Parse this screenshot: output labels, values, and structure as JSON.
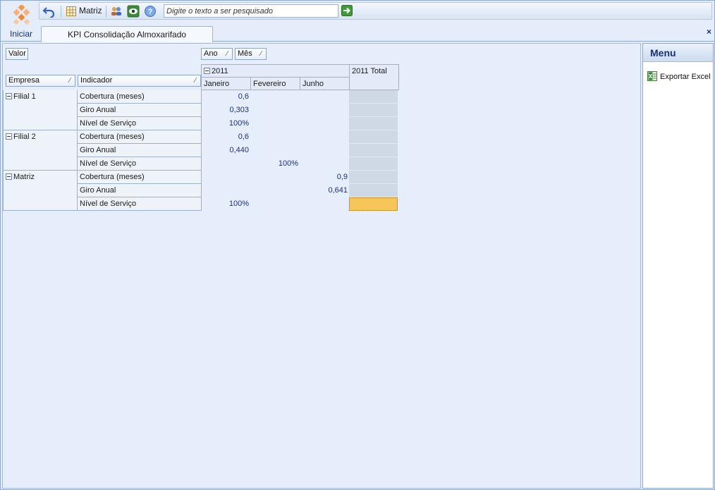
{
  "app": {
    "start_label": "Iniciar",
    "tab_label": "KPI Consolidação Almoxarifado",
    "close_glyph": "×"
  },
  "toolbar": {
    "undo_icon": "undo-icon",
    "matrix_icon": "grid-icon",
    "matrix_label": "Matriz",
    "users_icon": "users-icon",
    "view_icon": "eye-icon",
    "help_icon": "help-icon",
    "search_placeholder": "Digite o texto a ser pesquisado",
    "go_icon": "arrow-right-icon"
  },
  "pivot": {
    "data_field": "Valor",
    "column_fields": [
      "Ano",
      "Mês"
    ],
    "row_fields": [
      "Empresa",
      "Indicador"
    ],
    "year": "2011",
    "year_total": "2011 Total",
    "months": [
      "Janeiro",
      "Fevereiro",
      "Junho"
    ],
    "groups": [
      {
        "name": "Filial 1",
        "rows": [
          {
            "indicator": "Cobertura (meses)",
            "values": [
              "0,6",
              "",
              ""
            ]
          },
          {
            "indicator": "Giro Anual",
            "values": [
              "0,303",
              "",
              ""
            ]
          },
          {
            "indicator": "Nível de Serviço",
            "values": [
              "100%",
              "",
              ""
            ]
          }
        ]
      },
      {
        "name": "Filial 2",
        "rows": [
          {
            "indicator": "Cobertura (meses)",
            "values": [
              "0,6",
              "",
              ""
            ]
          },
          {
            "indicator": "Giro Anual",
            "values": [
              "0,440",
              "",
              ""
            ]
          },
          {
            "indicator": "Nível de Serviço",
            "values": [
              "",
              "100%",
              ""
            ]
          }
        ]
      },
      {
        "name": "Matriz",
        "rows": [
          {
            "indicator": "Cobertura (meses)",
            "values": [
              "",
              "",
              "0,9"
            ]
          },
          {
            "indicator": "Giro Anual",
            "values": [
              "",
              "",
              "0,641"
            ]
          },
          {
            "indicator": "Nível de Serviço",
            "values": [
              "100%",
              "",
              ""
            ]
          }
        ]
      }
    ]
  },
  "menu": {
    "title": "Menu",
    "items": [
      {
        "label": "Exportar Excel",
        "icon": "excel-icon"
      }
    ]
  },
  "colors": {
    "accent": "#15317a",
    "selected_cell": "#f7c65a",
    "total_cell": "#cfd9e6"
  }
}
